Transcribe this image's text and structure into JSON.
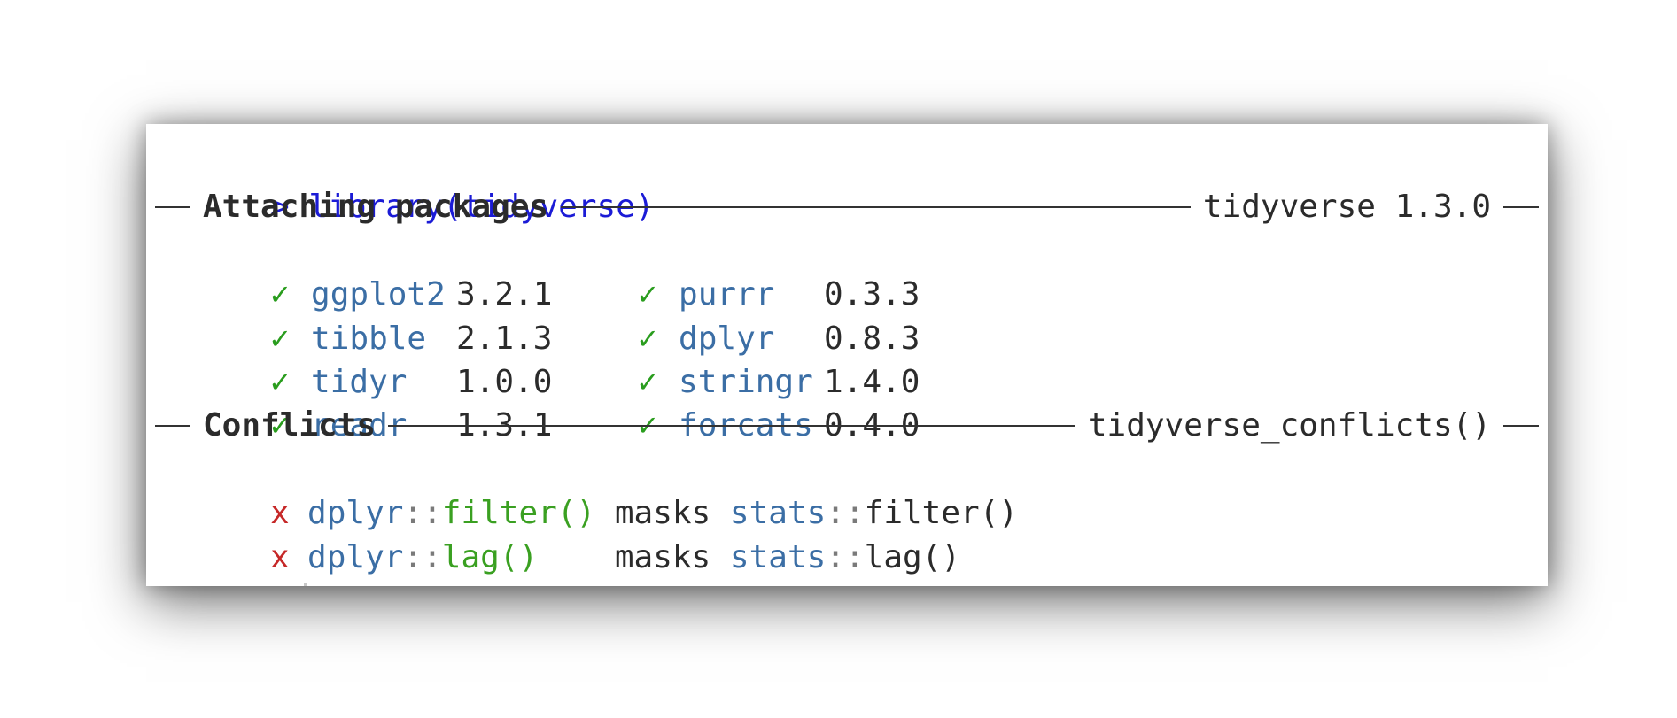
{
  "prompt_symbol": ">",
  "command": "library(tidyverse)",
  "attaching": {
    "title": "Attaching packages",
    "version_label": "tidyverse 1.3.0"
  },
  "packages": [
    {
      "check": "✓",
      "name": "ggplot2",
      "version": "3.2.1"
    },
    {
      "check": "✓",
      "name": "purrr",
      "version": "0.3.3"
    },
    {
      "check": "✓",
      "name": "tibble",
      "version": "2.1.3"
    },
    {
      "check": "✓",
      "name": "dplyr",
      "version": "0.8.3"
    },
    {
      "check": "✓",
      "name": "tidyr",
      "version": "1.0.0"
    },
    {
      "check": "✓",
      "name": "stringr",
      "version": "1.4.0"
    },
    {
      "check": "✓",
      "name": "readr",
      "version": "1.3.1"
    },
    {
      "check": "✓",
      "name": "forcats",
      "version": "0.4.0"
    }
  ],
  "conflicts": {
    "title": "Conflicts",
    "fn_label": "tidyverse_conflicts()",
    "items": [
      {
        "mark": "x",
        "ns": "dplyr",
        "sep": "::",
        "fn": "filter()",
        "verb": "masks",
        "masked_ns": "stats",
        "masked_sep": "::",
        "masked_fn": "filter()"
      },
      {
        "mark": "x",
        "ns": "dplyr",
        "sep": "::",
        "fn": "lag()",
        "verb": "masks",
        "masked_ns": "stats",
        "masked_sep": "::",
        "masked_fn": "lag()"
      }
    ]
  },
  "colors": {
    "prompt": "#1b1bd6",
    "package": "#3b6ea5",
    "check": "#2a9d1e",
    "cross": "#c62828",
    "function": "#3aa021"
  }
}
